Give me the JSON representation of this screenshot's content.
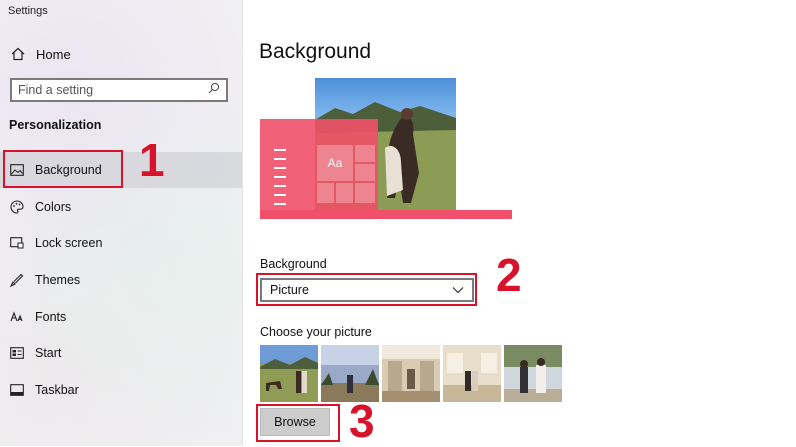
{
  "window": {
    "title": "Settings"
  },
  "sidebar": {
    "home_label": "Home",
    "search_placeholder": "Find a setting",
    "section_title": "Personalization",
    "items": [
      {
        "label": "Background",
        "icon": "picture-icon",
        "selected": true
      },
      {
        "label": "Colors",
        "icon": "palette-icon",
        "selected": false
      },
      {
        "label": "Lock screen",
        "icon": "lock-screen-icon",
        "selected": false
      },
      {
        "label": "Themes",
        "icon": "brush-icon",
        "selected": false
      },
      {
        "label": "Fonts",
        "icon": "font-icon",
        "selected": false
      },
      {
        "label": "Start",
        "icon": "start-icon",
        "selected": false
      },
      {
        "label": "Taskbar",
        "icon": "taskbar-icon",
        "selected": false
      }
    ]
  },
  "main": {
    "title": "Background",
    "preview": {
      "tile_text": "Aa"
    },
    "background_label": "Background",
    "background_value": "Picture",
    "choose_label": "Choose your picture",
    "browse_label": "Browse"
  },
  "annotations": [
    "1",
    "2",
    "3"
  ],
  "colors": {
    "annotation_red": "#d7122a",
    "accent_pink": "#f1506a"
  }
}
